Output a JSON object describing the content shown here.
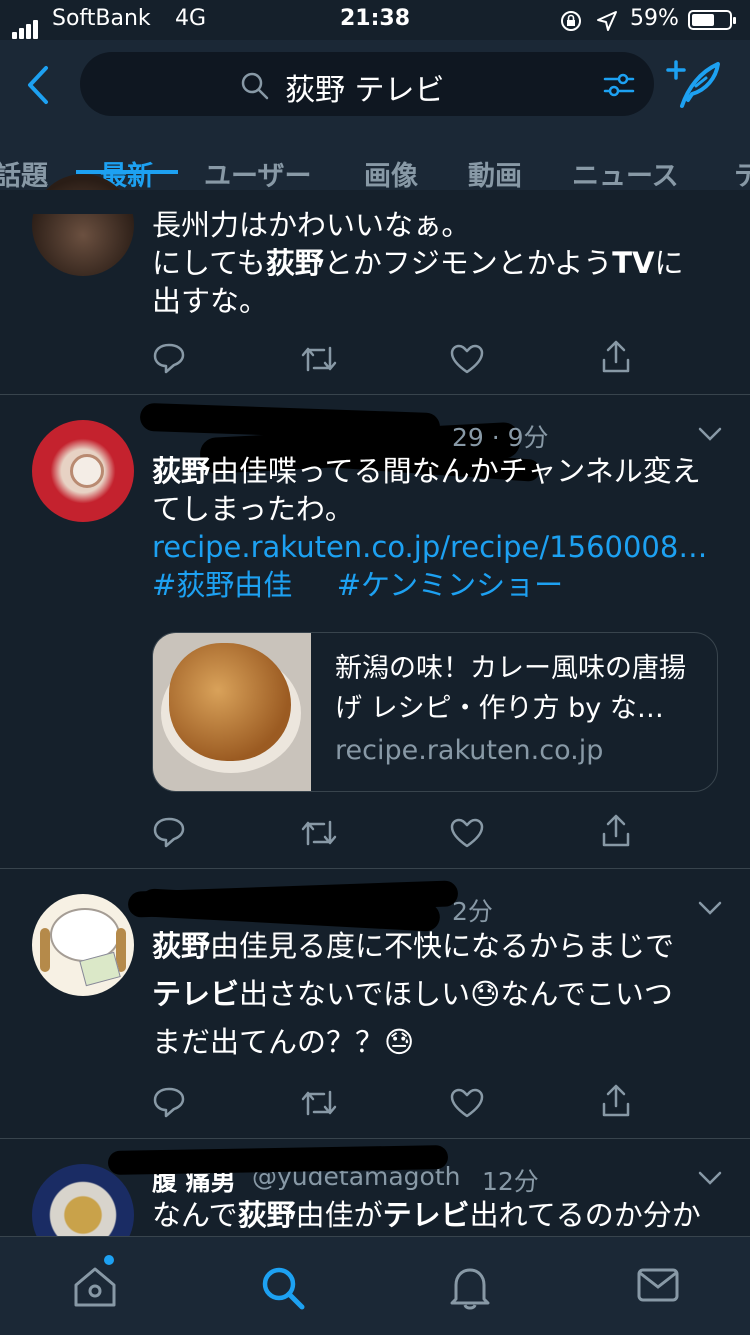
{
  "status_bar": {
    "carrier": "SoftBank",
    "network": "4G",
    "time": "21:38",
    "battery_percent": "59%",
    "battery_level": 0.59
  },
  "search": {
    "query": "荻野 テレビ"
  },
  "tabs": [
    {
      "label": "話題",
      "active": false
    },
    {
      "label": "最新",
      "active": true
    },
    {
      "label": "ユーザー",
      "active": false
    },
    {
      "label": "画像",
      "active": false
    },
    {
      "label": "動画",
      "active": false
    },
    {
      "label": "ニュース",
      "active": false
    },
    {
      "label": "テ",
      "active": false
    }
  ],
  "tweets": [
    {
      "text_lines": [
        "長州力はかわいいなぁ。",
        "にしても荻野とかフジモンとかようTVに",
        "出すな。"
      ],
      "bold_terms": [
        "荻野",
        "TV"
      ]
    },
    {
      "meta": "29 · 9分",
      "text_lines": [
        "荻野由佳喋ってる間なんかチャンネル変え",
        "てしまったわ。"
      ],
      "bold_terms": [
        "荻野"
      ],
      "link": "recipe.rakuten.co.jp/recipe/1560008…",
      "hashtags": [
        "#荻野由佳",
        "#ケンミンショー"
      ],
      "card": {
        "title": "新潟の味！カレー風味の唐揚げ レシピ・作り方 by な…",
        "domain": "recipe.rakuten.co.jp"
      }
    },
    {
      "meta": "2分",
      "text_lines": [
        "荻野由佳見る度に不快になるからまじで",
        "テレビ出さないでほしい😓なんでこいつ",
        "まだ出てんの？？😓"
      ],
      "bold_terms": [
        "荻野",
        "テレビ"
      ]
    },
    {
      "display_name": "腹 痛男",
      "handle": "@yudetamagoth",
      "time": "12分",
      "text": "なんで荻野由佳がテレビ出れてるのか分か",
      "bold_terms": [
        "荻野",
        "テレビ"
      ]
    }
  ],
  "bottom_nav": [
    "home-icon",
    "search-icon",
    "notifications-icon",
    "messages-icon"
  ],
  "colors": {
    "background": "#15202b",
    "header": "#1b2836",
    "accent": "#1da1f2",
    "secondary_text": "#8899a6",
    "divider": "#38444d"
  }
}
